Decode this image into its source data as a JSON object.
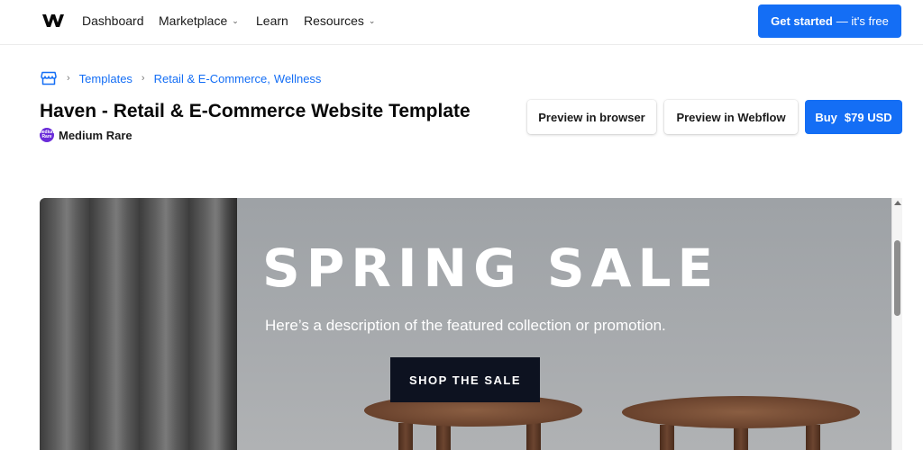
{
  "topnav": {
    "logo_icon": "webflow-logo-icon",
    "items": [
      {
        "label": "Dashboard",
        "has_dropdown": false
      },
      {
        "label": "Marketplace",
        "has_dropdown": true
      },
      {
        "label": "Learn",
        "has_dropdown": false
      },
      {
        "label": "Resources",
        "has_dropdown": true
      }
    ],
    "cta_bold": "Get started",
    "cta_light": "— it's free"
  },
  "breadcrumb": {
    "home_icon": "marketplace-store-icon",
    "items": [
      "Templates",
      "Retail & E-Commerce",
      "Wellness"
    ],
    "separator": ",",
    "chevron": "›"
  },
  "template": {
    "title": "Haven - Retail & E-Commerce Website Template",
    "author": "Medium Rare",
    "author_avatar_text": "Medium Rare"
  },
  "actions": {
    "preview_browser": "Preview in browser",
    "preview_webflow": "Preview in Webflow",
    "buy_label": "Buy",
    "buy_price": "$79 USD"
  },
  "preview": {
    "hero_title": "SPRING SALE",
    "hero_description": "Here’s a description of the featured collection or promotion.",
    "hero_button": "SHOP THE SALE"
  },
  "colors": {
    "accent": "#146ef5",
    "text": "#080808",
    "hero_button_bg": "#0d1220"
  }
}
